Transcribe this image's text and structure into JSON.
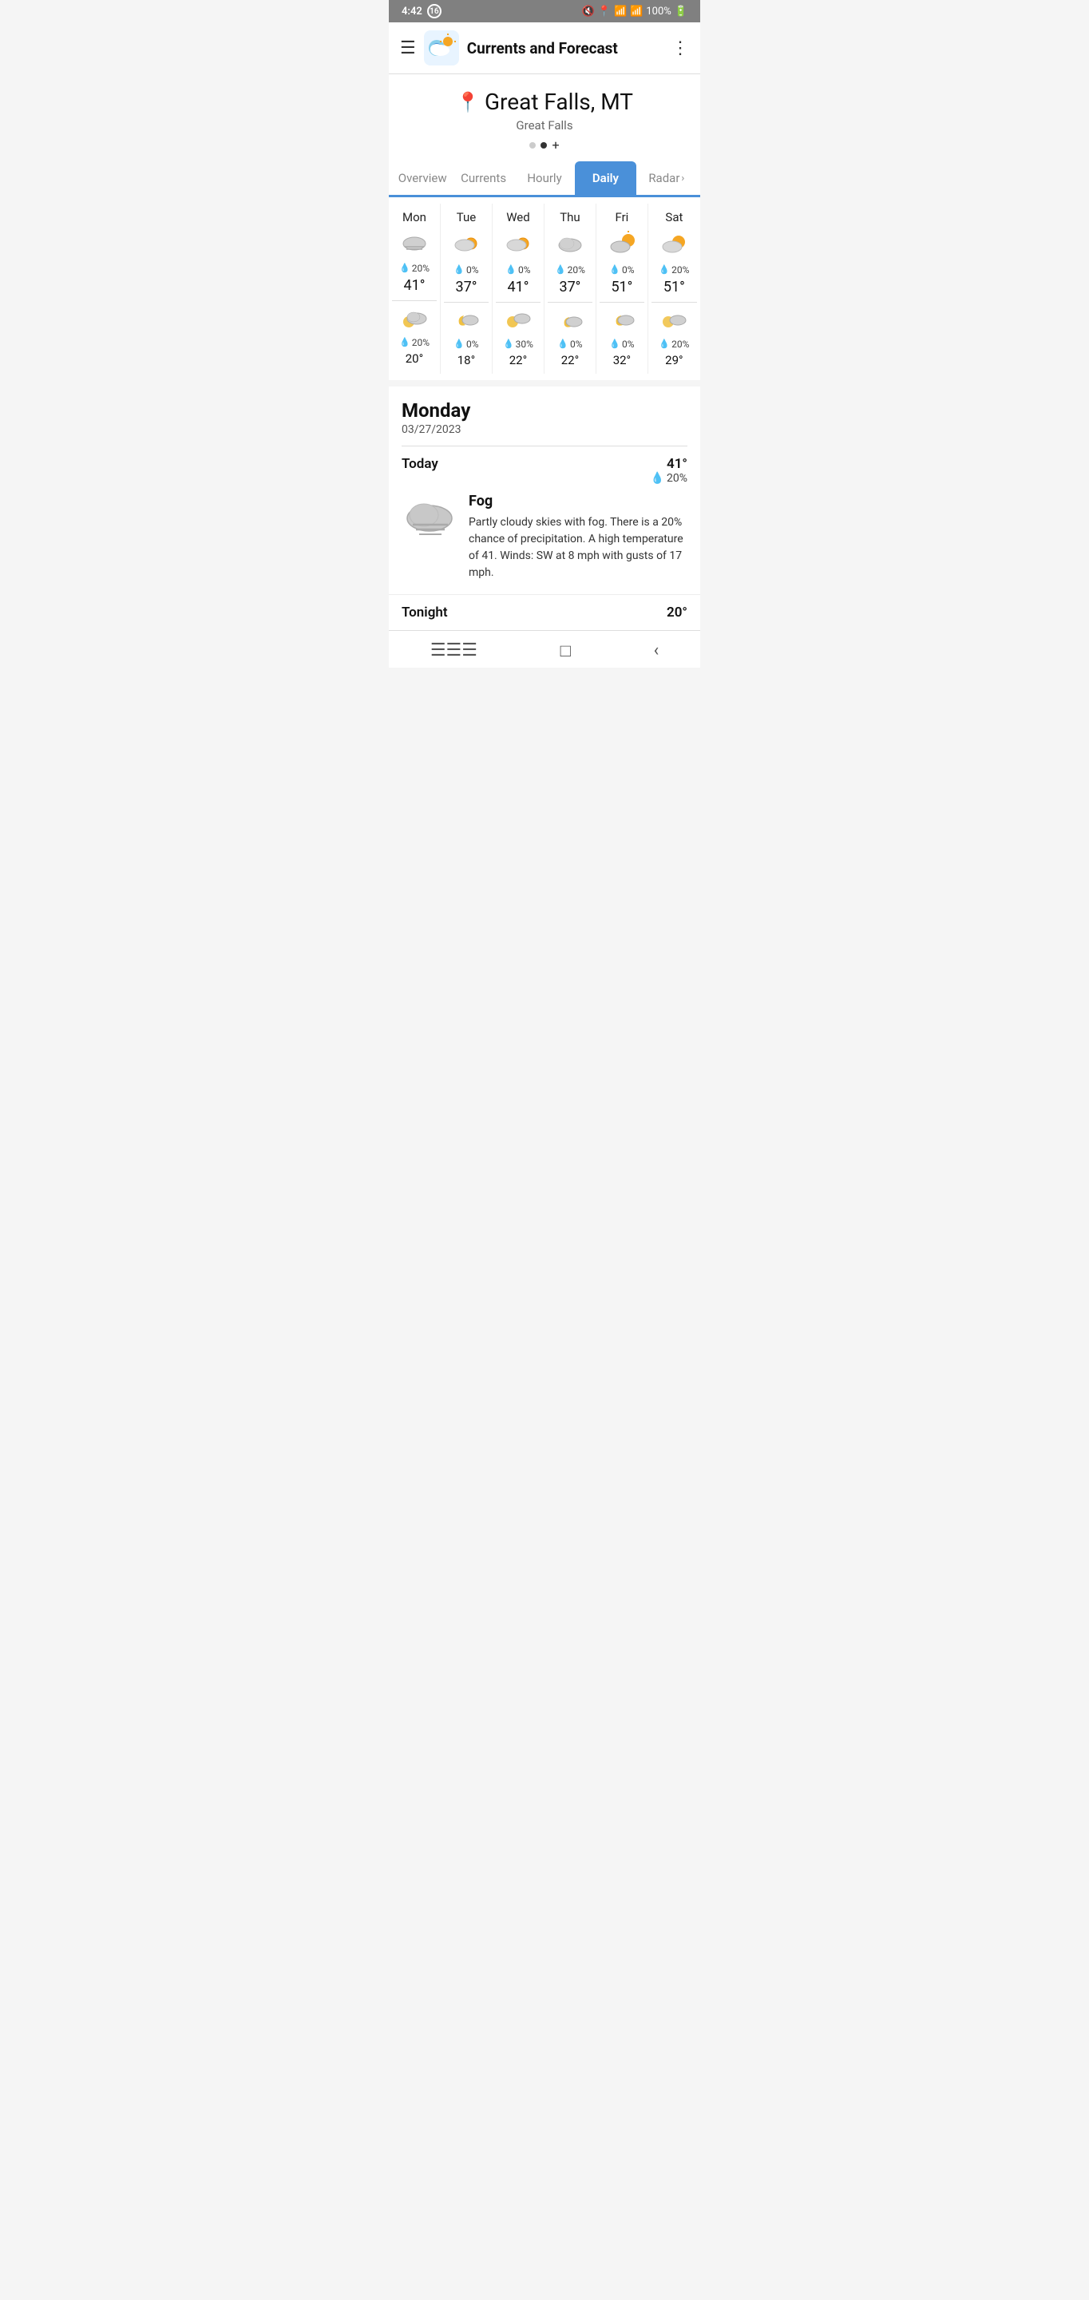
{
  "statusBar": {
    "time": "4:42",
    "notification": "16",
    "battery": "100%"
  },
  "navBar": {
    "title": "Currents and Forecast",
    "logoAlt": "Weather Authority"
  },
  "location": {
    "name": "Great Falls, MT",
    "sub": "Great Falls"
  },
  "tabs": {
    "items": [
      "Overview",
      "Currents",
      "Hourly",
      "Daily",
      "Radar"
    ],
    "activeIndex": 3
  },
  "dailyForecast": [
    {
      "day": "Mon",
      "dayIcon": "foggy",
      "precipDay": "20%",
      "highTemp": "41°",
      "nightIcon": "partly-cloudy-night",
      "precipNight": "20%",
      "lowTemp": "20°"
    },
    {
      "day": "Tue",
      "dayIcon": "partly-cloudy",
      "precipDay": "0%",
      "highTemp": "37°",
      "nightIcon": "cloudy-night",
      "precipNight": "0%",
      "lowTemp": "18°"
    },
    {
      "day": "Wed",
      "dayIcon": "partly-cloudy",
      "precipDay": "0%",
      "highTemp": "41°",
      "nightIcon": "partly-cloudy-night",
      "precipNight": "30%",
      "lowTemp": "22°"
    },
    {
      "day": "Thu",
      "dayIcon": "cloudy",
      "precipDay": "20%",
      "highTemp": "37°",
      "nightIcon": "crescent-night",
      "precipNight": "0%",
      "lowTemp": "22°"
    },
    {
      "day": "Fri",
      "dayIcon": "partly-sunny",
      "precipDay": "0%",
      "highTemp": "51°",
      "nightIcon": "cloudy-night",
      "precipNight": "0%",
      "lowTemp": "32°"
    },
    {
      "day": "Sat",
      "dayIcon": "partly-cloudy",
      "precipDay": "20%",
      "highTemp": "51°",
      "nightIcon": "partly-cloudy-night",
      "precipNight": "20%",
      "lowTemp": "29°"
    }
  ],
  "detailDay": {
    "name": "Monday",
    "date": "03/27/2023",
    "label": "Today",
    "highTemp": "41°",
    "precipPct": "20%",
    "condition": "Fog",
    "description": "Partly cloudy skies with fog. There is a 20% chance of precipitation. A high temperature of 41. Winds: SW at 8 mph with gusts of 17 mph."
  },
  "tonight": {
    "label": "Tonight",
    "temp": "20°"
  },
  "colors": {
    "accent": "#4a90d9",
    "precipBlue": "#3a7bd5",
    "activeTab": "#4a90d9",
    "sunYellow": "#f5a623",
    "moonYellow": "#f0c040"
  }
}
